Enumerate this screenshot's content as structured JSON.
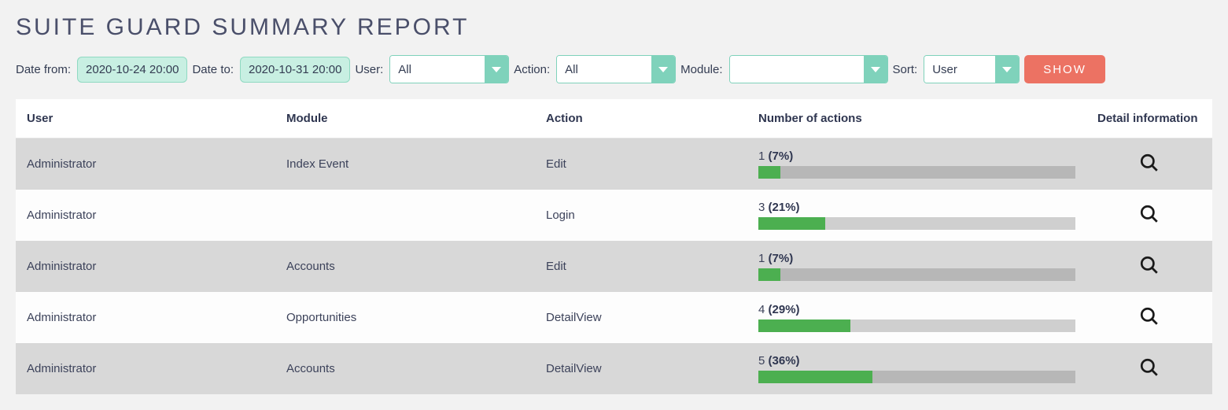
{
  "title": "SUITE GUARD SUMMARY REPORT",
  "filters": {
    "date_from_label": "Date from:",
    "date_from_value": "2020-10-24 20:00",
    "date_to_label": "Date to:",
    "date_to_value": "2020-10-31 20:00",
    "user_label": "User:",
    "user_value": "All",
    "action_label": "Action:",
    "action_value": "All",
    "module_label": "Module:",
    "module_value": "",
    "sort_label": "Sort:",
    "sort_value": "User",
    "show_button": "SHOW"
  },
  "columns": {
    "user": "User",
    "module": "Module",
    "action": "Action",
    "count": "Number of actions",
    "detail": "Detail information"
  },
  "rows": [
    {
      "user": "Administrator",
      "module": "Index Event",
      "action": "Edit",
      "count": "1",
      "pct_label": "(7%)",
      "pct": 7
    },
    {
      "user": "Administrator",
      "module": "",
      "action": "Login",
      "count": "3",
      "pct_label": "(21%)",
      "pct": 21
    },
    {
      "user": "Administrator",
      "module": "Accounts",
      "action": "Edit",
      "count": "1",
      "pct_label": "(7%)",
      "pct": 7
    },
    {
      "user": "Administrator",
      "module": "Opportunities",
      "action": "DetailView",
      "count": "4",
      "pct_label": "(29%)",
      "pct": 29
    },
    {
      "user": "Administrator",
      "module": "Accounts",
      "action": "DetailView",
      "count": "5",
      "pct_label": "(36%)",
      "pct": 36
    }
  ]
}
